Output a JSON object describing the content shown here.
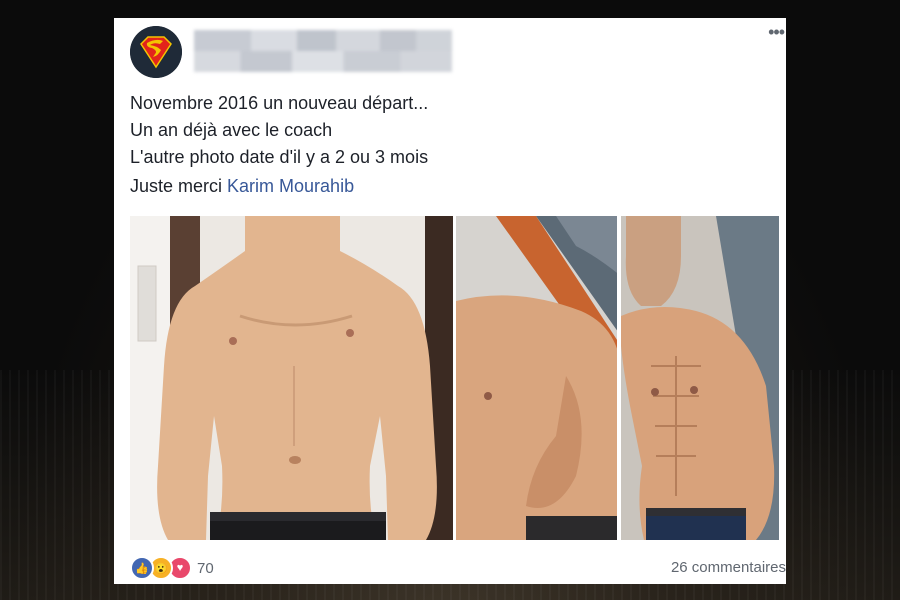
{
  "post": {
    "author_name": "",
    "lines": [
      "Novembre 2016 un nouveau départ...",
      "Un an déjà avec le coach",
      "L'autre photo date d'il y a 2 ou 3 mois"
    ],
    "thanks_prefix": "Juste merci ",
    "mention": "Karim Mourahib",
    "reaction_count": "70",
    "comments_label": "26 commentaires",
    "reaction_icons": [
      "like-icon",
      "wow-icon",
      "love-icon"
    ],
    "more_icon": "more-options-icon"
  },
  "colors": {
    "mention": "#385898",
    "like": "#4267b2",
    "wow": "#f7b125",
    "love": "#e9486b"
  }
}
